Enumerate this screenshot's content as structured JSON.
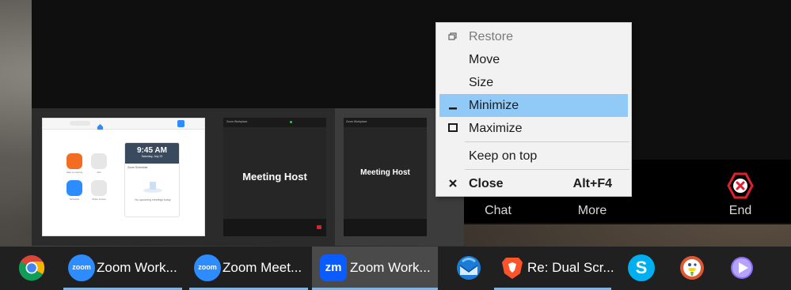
{
  "toolbar": {
    "chat_label": "Chat",
    "more_label": "More",
    "end_label": "End",
    "end_color": "#e0202e"
  },
  "previews": [
    {
      "kind": "zoom-home",
      "tabs": [
        "Home",
        "Chat",
        "Meetings",
        "Contacts",
        "Whiteboards"
      ],
      "actions": [
        {
          "label": "Start a meeting",
          "color": "#f26d21"
        },
        {
          "label": "Join",
          "color": "#e6e6e6"
        },
        {
          "label": "Schedule",
          "color": "#2d8cff"
        },
        {
          "label": "Share screen",
          "color": "#e6e6e6"
        }
      ],
      "clock_time": "9:45 AM",
      "clock_date": "Saturday, July 22",
      "note": "Zoom Scheduler",
      "no_meetings": "No upcoming meetings today"
    },
    {
      "kind": "meeting",
      "header": "Zoom Workplace",
      "host": "Meeting Host"
    },
    {
      "kind": "meeting",
      "header": "Zoom Workplace",
      "host": "Meeting Host"
    }
  ],
  "context_menu": {
    "items": [
      {
        "label": "Restore",
        "icon": "restore-icon",
        "disabled": true
      },
      {
        "label": "Move"
      },
      {
        "label": "Size"
      },
      {
        "label": "Minimize",
        "icon": "minimize-icon",
        "highlighted": true
      },
      {
        "label": "Maximize",
        "icon": "maximize-icon"
      },
      {
        "label": "Keep on top"
      },
      {
        "label": "Close",
        "icon": "close-icon",
        "shortcut": "Alt+F4",
        "bold": true
      }
    ],
    "highlight_color": "#91c9f7"
  },
  "taskbar": {
    "pinned": [
      {
        "name": "Chrome",
        "icon": "chrome-icon"
      },
      {
        "name": "Thunderbird",
        "icon": "thunderbird-icon"
      },
      {
        "name": "Skype",
        "icon": "skype-icon"
      },
      {
        "name": "DuckDuckGo",
        "icon": "duckduckgo-icon"
      },
      {
        "name": "Media player",
        "icon": "play-icon"
      }
    ],
    "windows": [
      {
        "label": "Zoom Work...",
        "icon_text": "zoom"
      },
      {
        "label": "Zoom Meet...",
        "icon_text": "zoom"
      },
      {
        "label": "Zoom Work...",
        "icon_text": "zm",
        "active": true
      },
      {
        "label": "Re: Dual Scr..."
      }
    ],
    "accent": "#7fb4e0"
  }
}
